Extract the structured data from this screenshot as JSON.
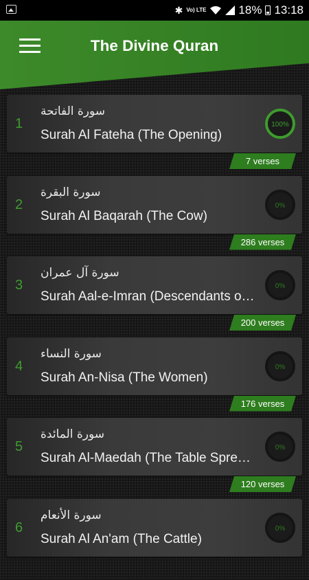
{
  "status_bar": {
    "lte_label": "Vo) LTE",
    "battery": "18%",
    "time": "13:18"
  },
  "header": {
    "title": "The Divine Quran"
  },
  "colors": {
    "accent_green": "#2e7d1f",
    "number_green": "#3f9c2e"
  },
  "surahs": [
    {
      "number": "1",
      "arabic": "سورة الفاتحة",
      "english": "Surah Al Fateha (The Opening)",
      "progress": 100,
      "progress_label": "100%",
      "verses": "7 verses"
    },
    {
      "number": "2",
      "arabic": "سورة البقرة",
      "english": "Surah Al Baqarah (The Cow)",
      "progress": 0,
      "progress_label": "0%",
      "verses": "286 verses"
    },
    {
      "number": "3",
      "arabic": "سورة آل عمران",
      "english": "Surah Aal-e-Imran (Descendants o…",
      "progress": 0,
      "progress_label": "0%",
      "verses": "200 verses"
    },
    {
      "number": "4",
      "arabic": "سورة النساء",
      "english": "Surah An-Nisa (The Women)",
      "progress": 0,
      "progress_label": "0%",
      "verses": "176 verses"
    },
    {
      "number": "5",
      "arabic": "سورة المائدة",
      "english": "Surah Al-Maedah (The Table Spre…",
      "progress": 0,
      "progress_label": "0%",
      "verses": "120 verses"
    },
    {
      "number": "6",
      "arabic": "سورة الأنعام",
      "english": "Surah Al An'am (The Cattle)",
      "progress": 0,
      "progress_label": "0%",
      "verses": ""
    }
  ]
}
